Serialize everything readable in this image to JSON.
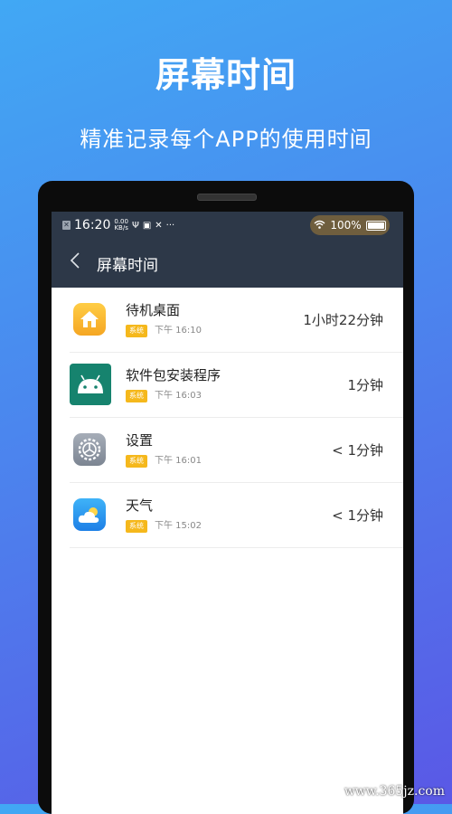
{
  "hero": {
    "title": "屏幕时间",
    "subtitle": "精准记录每个APP的使用时间"
  },
  "statusbar": {
    "time": "16:20",
    "speed_value": "0.00",
    "speed_unit": "KB/s",
    "battery": "100%"
  },
  "appbar": {
    "back_icon": "chevron-left-icon",
    "title": "屏幕时间"
  },
  "apps": [
    {
      "name": "待机桌面",
      "tag": "系统",
      "time": "下午 16:10",
      "duration": "1小时22分钟",
      "icon": "home-icon"
    },
    {
      "name": "软件包安装程序",
      "tag": "系统",
      "time": "下午 16:03",
      "duration": "1分钟",
      "icon": "android-icon"
    },
    {
      "name": "设置",
      "tag": "系统",
      "time": "下午 16:01",
      "duration": "< 1分钟",
      "icon": "settings-icon"
    },
    {
      "name": "天气",
      "tag": "系统",
      "time": "下午 15:02",
      "duration": "< 1分钟",
      "icon": "weather-icon"
    }
  ],
  "watermark": "www.365jz.com",
  "colors": {
    "appbar": "#2d3848",
    "badge": "#f5b81c",
    "bg_top": "#41a8f4",
    "bg_bottom": "#5a58e6"
  }
}
